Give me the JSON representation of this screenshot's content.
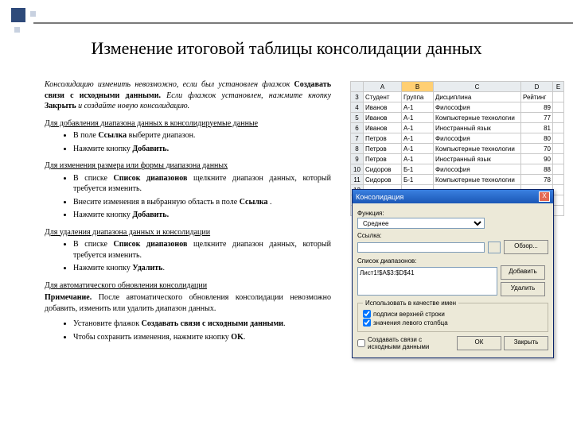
{
  "title": "Изменение итоговой таблицы консолидации данных",
  "intro": {
    "t1": "Консолидацию изменить невозможно, если был установлен флажок ",
    "b1": "Создавать связи с исходными данными.",
    "t2": " Если флажок установлен, нажмите кнопку ",
    "b2": "Закрыть",
    "t3": " и создайте новую консолидацию."
  },
  "s1": {
    "h": "Для добавления диапазона данных в консолидируемые данные",
    "li1a": "В поле ",
    "li1b": "Ссылка",
    "li1c": " выберите диапазон.",
    "li2a": " Нажмите кнопку ",
    "li2b": "Добавить."
  },
  "s2": {
    "h": "Для изменения размера или формы диапазона данных",
    "li1a": "В списке ",
    "li1b": "Список диапазонов",
    "li1c": " щелкните диапазон данных, который требуется изменить.",
    "li2a": "Внесите изменения в выбранную область в поле ",
    "li2b": "Ссылка",
    "li2c": " .",
    "li3a": "Нажмите кнопку ",
    "li3b": "Добавить."
  },
  "s3": {
    "h": "Для удаления диапазона данных и консолидации",
    "li1a": "В списке ",
    "li1b": "Список диапазонов",
    "li1c": " щелкните диапазон данных, который требуется изменить.",
    "li2a": "Нажмите кнопку ",
    "li2b": "Удалить",
    "li2c": "."
  },
  "s4": {
    "h": "Для автоматического обновления консолидации",
    "note_l": "Примечание.",
    "note_t": " После автоматического обновления консолидации невозможно добавить, изменить или удалить диапазон данных.",
    "li1a": "Установите флажок ",
    "li1b": "Создавать связи с исходными данными",
    "li1c": ".",
    "li2a": "Чтобы сохранить изменения, нажмите кнопку ",
    "li2b": "OK",
    "li2c": "."
  },
  "sheet": {
    "cols": [
      "A",
      "B",
      "C",
      "D",
      "E"
    ],
    "selColIndex": 1,
    "headers": [
      "Студент",
      "Группа",
      "Дисциплина",
      "Рейтинг"
    ],
    "rows": [
      {
        "n": "3"
      },
      {
        "n": "4",
        "c": [
          "Иванов",
          "А-1",
          "Философия",
          "89"
        ]
      },
      {
        "n": "5",
        "c": [
          "Иванов",
          "А-1",
          "Компьютерные технологии",
          "77"
        ]
      },
      {
        "n": "6",
        "c": [
          "Иванов",
          "А-1",
          "Иностранный язык",
          "81"
        ]
      },
      {
        "n": "7",
        "c": [
          "Петров",
          "А-1",
          "Философия",
          "80"
        ]
      },
      {
        "n": "8",
        "c": [
          "Петров",
          "А-1",
          "Компьютерные технологии",
          "70"
        ]
      },
      {
        "n": "9",
        "c": [
          "Петров",
          "А-1",
          "Иностранный язык",
          "90"
        ]
      },
      {
        "n": "10",
        "c": [
          "Сидоров",
          "Б-1",
          "Философия",
          "88"
        ]
      },
      {
        "n": "11",
        "c": [
          "Сидоров",
          "Б-1",
          "Компьютерные технологии",
          "78"
        ]
      },
      {
        "n": "12"
      },
      {
        "n": "13"
      },
      {
        "n": "14"
      }
    ]
  },
  "dlg": {
    "title": "Консолидация",
    "close": "X",
    "funcLabel": "Функция:",
    "funcValue": "Среднее",
    "refLabel": "Ссылка:",
    "refValue": "",
    "browse": "Обзор...",
    "listLabel": "Список диапазонов:",
    "listItem": "Лист1!$A$3:$D$41",
    "add": "Добавить",
    "del": "Удалить",
    "groupLegend": "Использовать в качестве имен",
    "chkTop": "подписи верхней строки",
    "chkLeft": "значения левого столбца",
    "chkLinks": "Создавать связи с исходными данными",
    "ok": "ОК",
    "cancel": "Закрыть"
  }
}
